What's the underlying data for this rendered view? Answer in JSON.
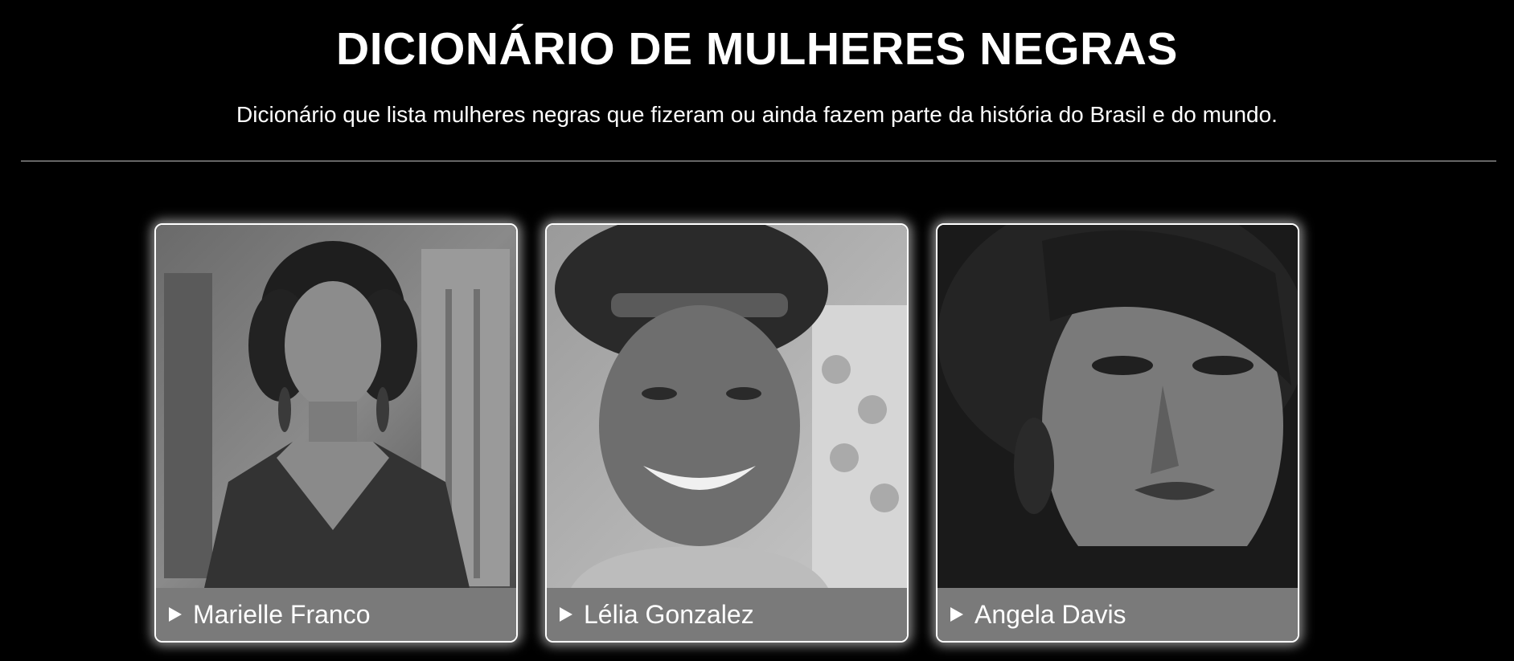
{
  "header": {
    "title": "DICIONÁRIO DE MULHERES NEGRAS",
    "subtitle": "Dicionário que lista mulheres negras que fizeram ou ainda fazem parte da história do Brasil e do mundo."
  },
  "cards": [
    {
      "name": "Marielle Franco"
    },
    {
      "name": "Lélia Gonzalez"
    },
    {
      "name": "Angela Davis"
    }
  ],
  "icons": {
    "caption_arrow": "play-triangle-icon"
  },
  "colors": {
    "background": "#000000",
    "text": "#ffffff",
    "caption_background": "#7a7a7a",
    "divider": "#bfbfbf"
  }
}
